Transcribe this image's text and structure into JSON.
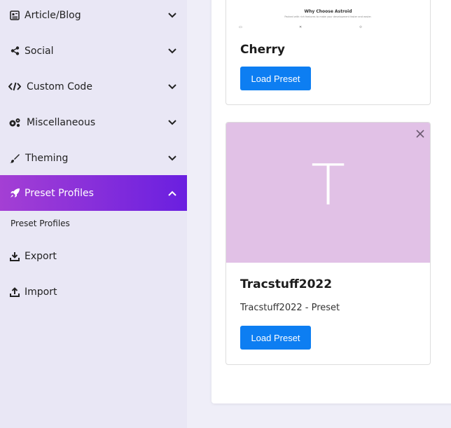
{
  "sidebar": {
    "items": [
      {
        "label": "Article/Blog",
        "icon": "article-icon"
      },
      {
        "label": "Social",
        "icon": "share-icon"
      },
      {
        "label": "Custom Code",
        "icon": "code-icon"
      },
      {
        "label": "Miscellaneous",
        "icon": "gears-icon"
      },
      {
        "label": "Theming",
        "icon": "brush-icon"
      },
      {
        "label": "Preset Profiles",
        "icon": "rocket-icon",
        "active": true
      },
      {
        "label": "Export",
        "icon": "download-icon"
      },
      {
        "label": "Import",
        "icon": "upload-icon"
      }
    ],
    "subitem": "Preset Profiles"
  },
  "cards": [
    {
      "thumb_title": "Why Choose Astroid",
      "thumb_subtitle": "Packed with rich features to make your development faster and easier.",
      "title": "Cherry",
      "button": "Load Preset"
    },
    {
      "preview_letter": "T",
      "preview_color": "#e1c1e6",
      "title": "Tracstuff2022",
      "description": "Tracstuff2022 - Preset",
      "button": "Load Preset"
    }
  ],
  "colors": {
    "accent_start": "#a43fd4",
    "accent_end": "#6a1fe0",
    "button": "#0d7ef2"
  }
}
